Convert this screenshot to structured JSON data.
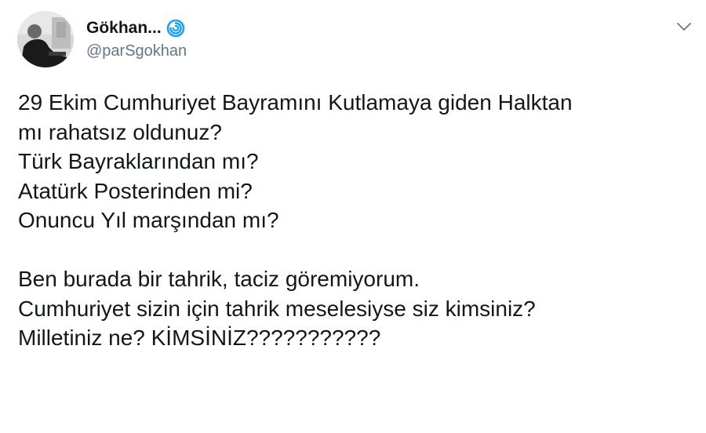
{
  "tweet": {
    "author": {
      "display_name": "Gökhan...",
      "handle": "@parSgokhan",
      "verified_icon": "verified-badge-icon",
      "avatar": "profile-photo-grayscale"
    },
    "menu_icon": "chevron-down-icon",
    "paragraphs": [
      [
        "29 Ekim Cumhuriyet Bayramını Kutlamaya giden Halktan",
        "mı rahatsız oldunuz?",
        "Türk Bayraklarından mı?",
        "Atatürk Posterinden mi?",
        "Onuncu Yıl marşından mı?"
      ],
      [
        "Ben burada bir tahrik, taciz göremiyorum.",
        "Cumhuriyet sizin için tahrik meselesiyse siz kimsiniz?",
        "Milletiniz ne? KİMSİNİZ???????????"
      ]
    ],
    "colors": {
      "text": "#14171a",
      "secondary": "#657786",
      "verified": "#1da1f2"
    }
  }
}
